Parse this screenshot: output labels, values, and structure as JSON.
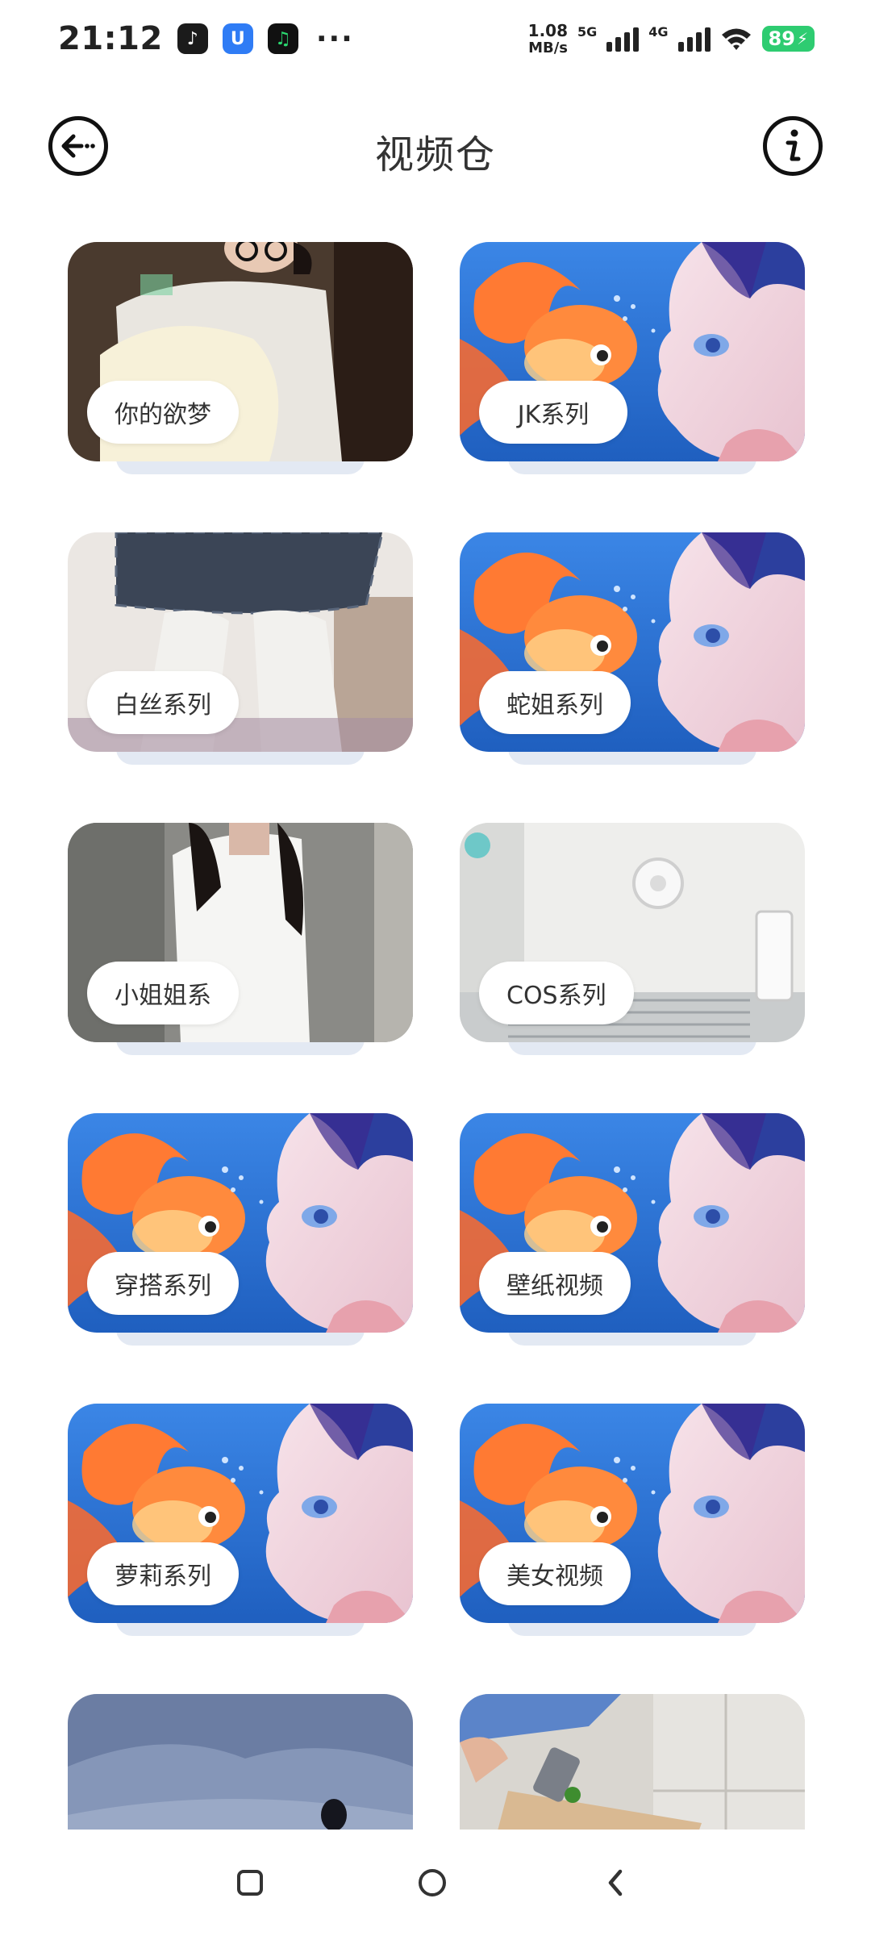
{
  "status_bar": {
    "time": "21:12",
    "speed_value": "1.08",
    "speed_unit": "MB/s",
    "net1": "5G",
    "net2": "4G",
    "battery": "89",
    "more": "···"
  },
  "header": {
    "title": "视频仓"
  },
  "categories": [
    {
      "label": "你的欲梦",
      "thumb": "photo-girl-cat"
    },
    {
      "label": "JK系列",
      "thumb": "fish-girl"
    },
    {
      "label": "白丝系列",
      "thumb": "photo-skirt"
    },
    {
      "label": "蛇姐系列",
      "thumb": "fish-girl"
    },
    {
      "label": "小姐姐系",
      "thumb": "photo-white-shirt"
    },
    {
      "label": "COS系列",
      "thumb": "photo-room"
    },
    {
      "label": "穿搭系列",
      "thumb": "fish-girl"
    },
    {
      "label": "壁纸视频",
      "thumb": "fish-girl"
    },
    {
      "label": "萝莉系列",
      "thumb": "fish-girl"
    },
    {
      "label": "美女视频",
      "thumb": "fish-girl"
    },
    {
      "label": "",
      "thumb": "photo-snow"
    },
    {
      "label": "",
      "thumb": "photo-kitchen"
    }
  ],
  "colors": {
    "fish_bg": "#2a6fd1",
    "pill_bg": "#ffffff",
    "battery": "#2ecc71"
  }
}
